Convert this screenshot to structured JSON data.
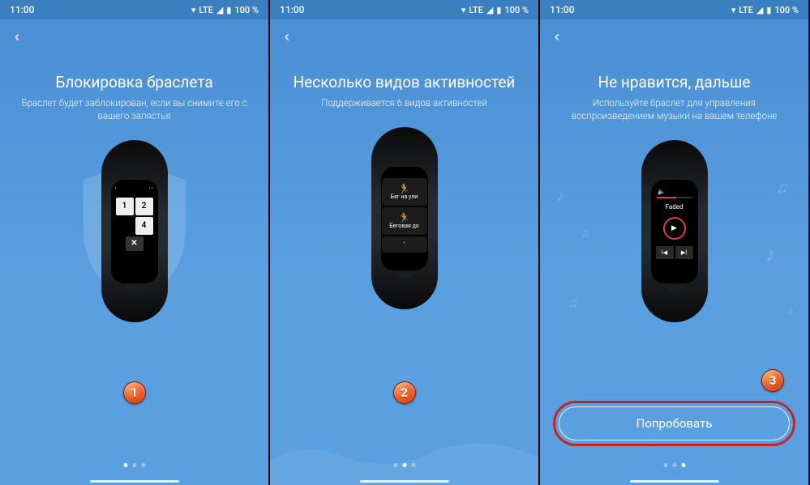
{
  "status": {
    "time": "11:00",
    "lte": "LTE",
    "battery": "100 %"
  },
  "screens": [
    {
      "title": "Блокировка браслета",
      "subtitle": "Браслет будет заблокирован, если вы снимите его с вашего запястья",
      "step": "1",
      "dots_active": 0,
      "band_keys": [
        "1",
        "2",
        "",
        "4"
      ],
      "band_del": "✕"
    },
    {
      "title": "Несколько видов активностей",
      "subtitle": "Поддерживается 6 видов активностей",
      "step": "2",
      "dots_active": 1,
      "activities": [
        "Бег на ули",
        "Беговая до"
      ]
    },
    {
      "title": "Не нравится, дальше",
      "subtitle": "Используйте браслет для управления воспроизведением музыки на вашем телефоне",
      "step": "3",
      "dots_active": 2,
      "music": {
        "track": "Faded",
        "play": "▶",
        "prev": "I◀",
        "next": "▶I"
      },
      "cta": "Попробовать"
    }
  ]
}
